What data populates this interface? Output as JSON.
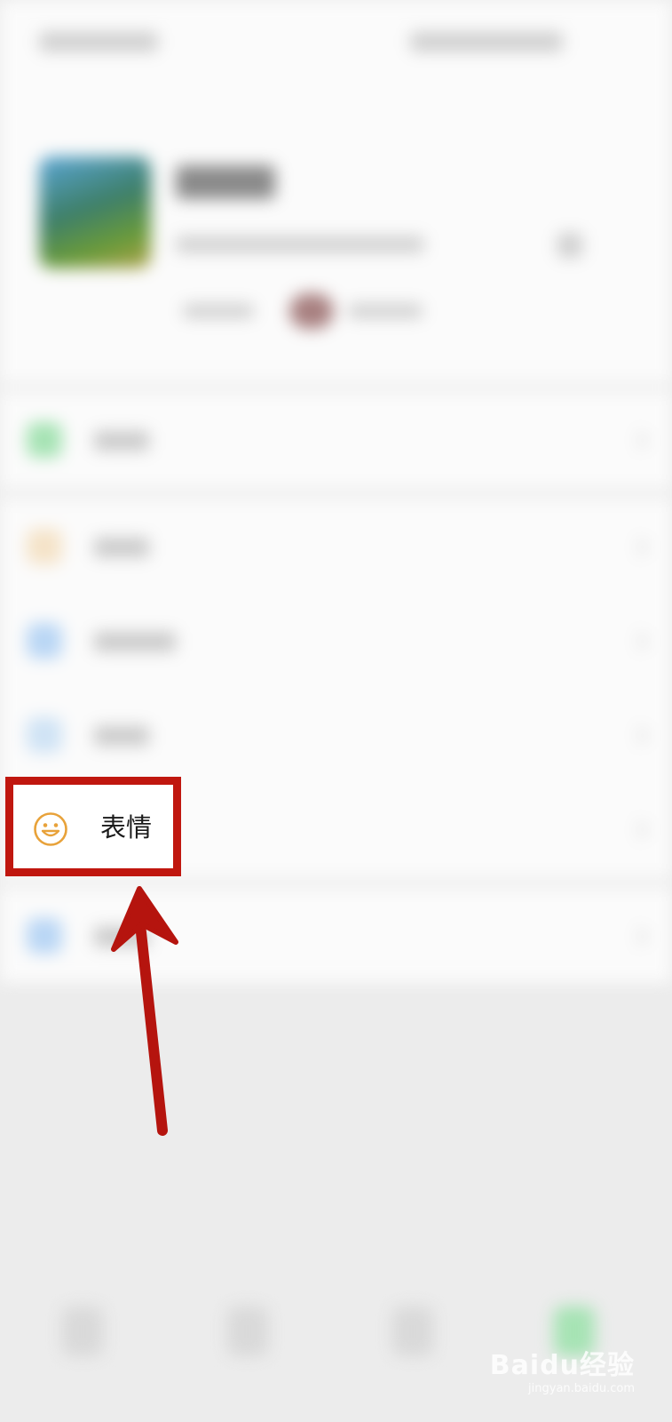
{
  "highlighted_item": {
    "label": "表情",
    "icon": "smiley-face-icon",
    "icon_color": "#e8a23a",
    "highlight_color": "#c0170f"
  },
  "arrow_color": "#c0170f",
  "watermark": {
    "brand": "Baidu经验",
    "url": "jingyan.baidu.com"
  }
}
